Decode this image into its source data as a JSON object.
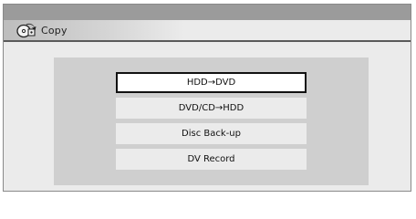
{
  "window": {
    "title": "Copy",
    "icon": "copy-disc-icon"
  },
  "menu": {
    "items": [
      {
        "label": "HDD→DVD",
        "selected": true
      },
      {
        "label": "DVD/CD→HDD",
        "selected": false
      },
      {
        "label": "Disc Back-up",
        "selected": false
      },
      {
        "label": "DV Record",
        "selected": false
      }
    ]
  },
  "colors": {
    "header_band": "#9b9b9b",
    "frame_background": "#ebebeb",
    "panel_background": "#cfcfcf",
    "selected_border": "#111111"
  }
}
